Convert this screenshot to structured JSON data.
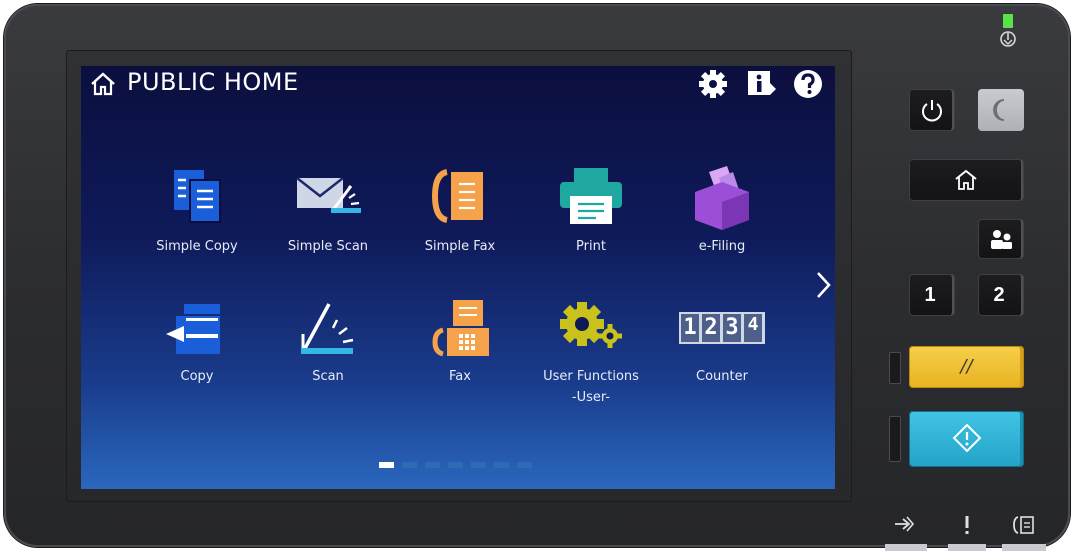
{
  "screen": {
    "title": "PUBLIC HOME",
    "top_icons": [
      "gear-icon",
      "info-icon",
      "help-icon"
    ],
    "apps": [
      {
        "label": "Simple Copy",
        "icon": "simple-copy-icon"
      },
      {
        "label": "Simple Scan",
        "icon": "simple-scan-icon"
      },
      {
        "label": "Simple Fax",
        "icon": "simple-fax-icon"
      },
      {
        "label": "Print",
        "icon": "print-icon"
      },
      {
        "label": "e-Filing",
        "icon": "e-filing-icon"
      },
      {
        "label": "Copy",
        "icon": "copy-icon"
      },
      {
        "label": "Scan",
        "icon": "scan-icon"
      },
      {
        "label": "Fax",
        "icon": "fax-icon"
      },
      {
        "label": "User Functions",
        "label2": "-User-",
        "icon": "user-functions-icon"
      },
      {
        "label": "Counter",
        "icon": "counter-icon"
      }
    ],
    "counter_digits": [
      "1",
      "2",
      "3",
      "4"
    ],
    "pages": 7,
    "current_page": 1
  },
  "panel": {
    "memory_key_1": "1",
    "memory_key_2": "2",
    "clear_symbol": "//",
    "footer_icons": [
      "login-icon",
      "error-icon",
      "fax-line-icon"
    ]
  },
  "colors": {
    "screen_top": "#0b0f3e",
    "screen_bottom": "#2a67bd",
    "copy_blue": "#1a5fd9",
    "fax_orange": "#f5a24a",
    "print_teal": "#1fa8a0",
    "efiling_purple": "#9a4fd6",
    "user_func_yellow": "#c8c21a",
    "clear_yellow": "#f2c230",
    "start_cyan": "#2fb6d8",
    "led_green": "#5ee04e"
  }
}
